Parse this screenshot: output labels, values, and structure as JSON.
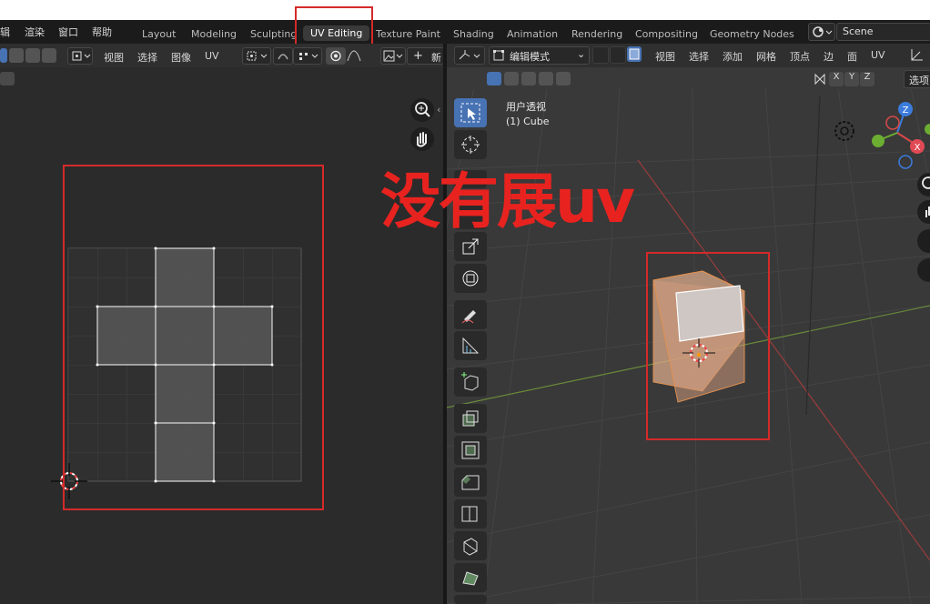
{
  "top_menu": [
    "辑",
    "渲染",
    "窗口",
    "帮助"
  ],
  "workspace_tabs": [
    {
      "label": "Layout",
      "active": false
    },
    {
      "label": "Modeling",
      "active": false
    },
    {
      "label": "Sculpting",
      "active": false
    },
    {
      "label": "UV Editing",
      "active": true
    },
    {
      "label": "Texture Paint",
      "active": false
    },
    {
      "label": "Shading",
      "active": false
    },
    {
      "label": "Animation",
      "active": false
    },
    {
      "label": "Rendering",
      "active": false
    },
    {
      "label": "Compositing",
      "active": false
    },
    {
      "label": "Geometry Nodes",
      "active": false
    }
  ],
  "scene": {
    "name": "Scene"
  },
  "uv_editor": {
    "menus": [
      "视图",
      "选择",
      "图像",
      "UV"
    ],
    "new_button": "新"
  },
  "viewport": {
    "mode": "编辑模式",
    "menus": [
      "视图",
      "选择",
      "添加",
      "网格",
      "顶点",
      "边",
      "面",
      "UV"
    ],
    "options_label": "选项",
    "view_name": "用户透视",
    "object_name": "(1) Cube",
    "axis_lock": [
      "X",
      "Y",
      "Z"
    ],
    "gizmo_axes": {
      "z": "Z",
      "x": "X"
    }
  },
  "annotation": {
    "text": "没有展uv",
    "color": "#e8231f"
  },
  "colors": {
    "accent": "#4772b3",
    "annotation_box": "#d42a2a",
    "mesh_face": "#d9a98a"
  }
}
